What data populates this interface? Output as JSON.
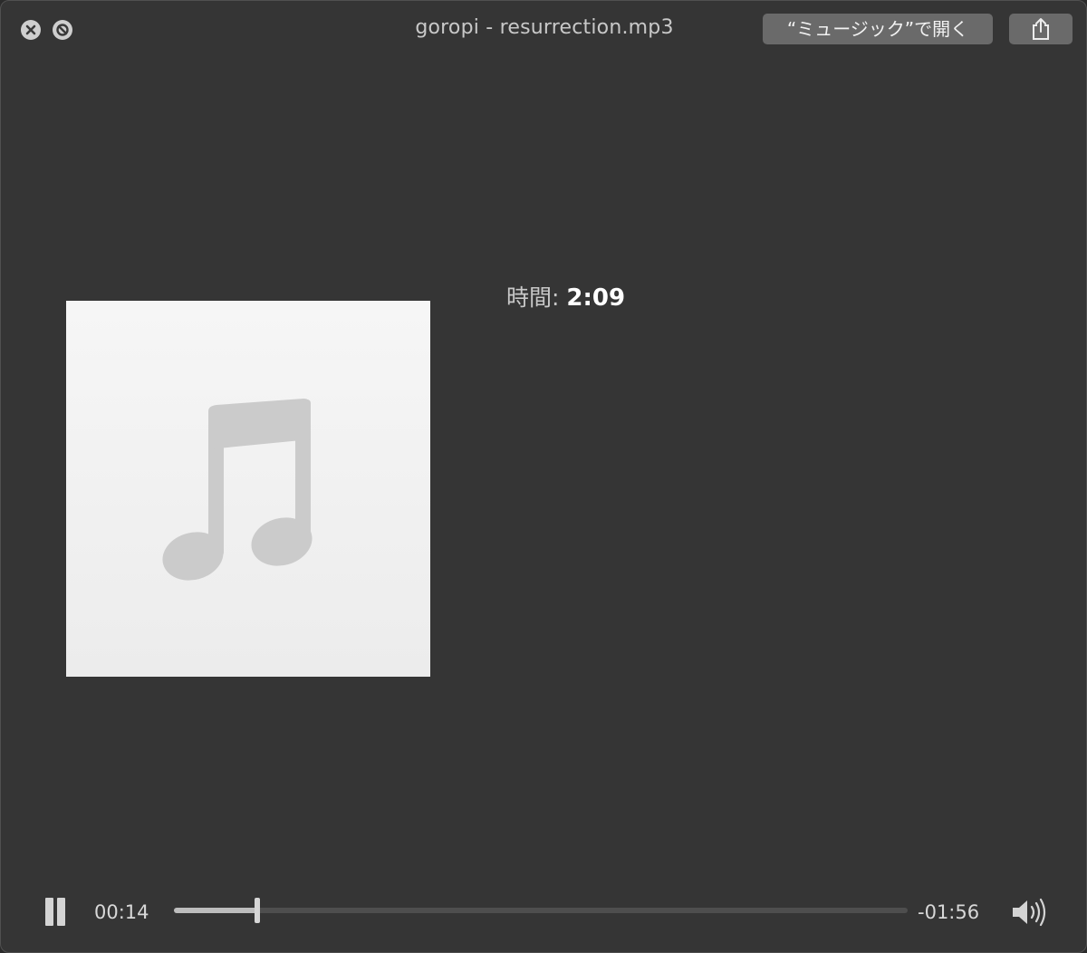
{
  "window": {
    "title": "goropi - resurrection.mp3",
    "open_with_button_label": "“ミュージック”で開く",
    "close_icon": "close-icon",
    "fullscreen_icon": "fullscreen-icon",
    "share_icon": "share-icon"
  },
  "info": {
    "duration_label": "時間:",
    "duration_value": "2:09"
  },
  "artwork": {
    "icon": "music-note-icon"
  },
  "playback": {
    "state": "playing",
    "pause_icon": "pause-icon",
    "elapsed": "00:14",
    "remaining": "-01:56",
    "progress_fraction": 0.114,
    "volume_icon": "volume-icon"
  },
  "colors": {
    "window_background": "#353535",
    "button_background": "#6a6a6a",
    "artwork_background": "#f2f2f2",
    "note_color": "#cbcbcb"
  }
}
